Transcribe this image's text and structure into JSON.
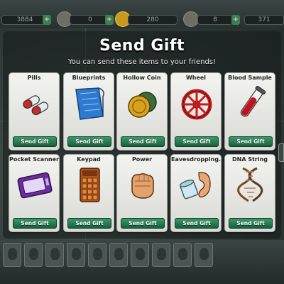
{
  "hud": {
    "coins": "3884",
    "xp": "0",
    "energy": "280",
    "mood": "8",
    "cash": "371"
  },
  "modal": {
    "title": "Send Gift",
    "subtitle": "You can send these items to your friends!"
  },
  "gifts": [
    {
      "name": "Pills",
      "button": "Send Gift",
      "icon": "pills-icon"
    },
    {
      "name": "Blueprints",
      "button": "Send Gift",
      "icon": "blueprints-icon"
    },
    {
      "name": "Hollow Coin",
      "button": "Send Gift",
      "icon": "hollow-coin-icon"
    },
    {
      "name": "Wheel",
      "button": "Send Gift",
      "icon": "wheel-icon"
    },
    {
      "name": "Blood Sample",
      "button": "Send Gift",
      "icon": "blood-sample-icon"
    },
    {
      "name": "Pocket Scanner",
      "button": "Send Gift",
      "icon": "pocket-scanner-icon"
    },
    {
      "name": "Keypad",
      "button": "Send Gift",
      "icon": "keypad-icon"
    },
    {
      "name": "Power",
      "button": "Send Gift",
      "icon": "power-fist-icon"
    },
    {
      "name": "Eavesdropping...",
      "button": "Send Gift",
      "icon": "eavesdropping-icon"
    },
    {
      "name": "DNA String",
      "button": "Send Gift",
      "icon": "dna-string-icon"
    }
  ],
  "colors": {
    "button_green": "#2a7f55",
    "card_bg": "#ecece8",
    "title_text": "#ffffff"
  }
}
